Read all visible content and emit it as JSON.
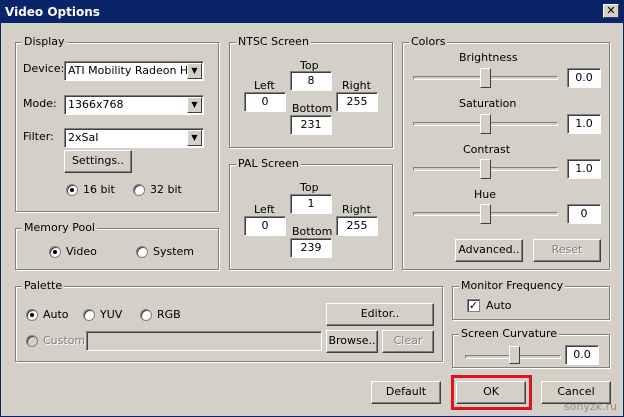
{
  "window": {
    "title": "Video Options"
  },
  "display": {
    "legend": "Display",
    "device_label": "Device:",
    "device_value": "ATI Mobility Radeon HD",
    "mode_label": "Mode:",
    "mode_value": "1366x768",
    "filter_label": "Filter:",
    "filter_value": "2xSaI",
    "settings_btn": "Settings..",
    "bit16": "16 bit",
    "bit32": "32 bit"
  },
  "ntsc": {
    "legend": "NTSC Screen",
    "top_label": "Top",
    "top": "8",
    "left_label": "Left",
    "left": "0",
    "right_label": "Right",
    "right": "255",
    "bottom_label": "Bottom",
    "bottom": "231"
  },
  "pal": {
    "legend": "PAL Screen",
    "top_label": "Top",
    "top": "1",
    "left_label": "Left",
    "left": "0",
    "right_label": "Right",
    "right": "255",
    "bottom_label": "Bottom",
    "bottom": "239"
  },
  "colors": {
    "legend": "Colors",
    "brightness_label": "Brightness",
    "brightness": "0.0",
    "saturation_label": "Saturation",
    "saturation": "1.0",
    "contrast_label": "Contrast",
    "contrast": "1.0",
    "hue_label": "Hue",
    "hue": "0",
    "advanced_btn": "Advanced..",
    "reset_btn": "Reset"
  },
  "memory": {
    "legend": "Memory Pool",
    "video": "Video",
    "system": "System"
  },
  "palette": {
    "legend": "Palette",
    "auto": "Auto",
    "yuv": "YUV",
    "rgb": "RGB",
    "custom": "Custom",
    "editor_btn": "Editor..",
    "browse_btn": "Browse..",
    "clear_btn": "Clear"
  },
  "monitor": {
    "legend": "Monitor Frequency",
    "auto": "Auto"
  },
  "curvature": {
    "legend": "Screen Curvature",
    "value": "0.0"
  },
  "footer": {
    "default_btn": "Default",
    "ok_btn": "OK",
    "cancel_btn": "Cancel"
  },
  "watermark": "sonyzk.ru",
  "colors_hex": {
    "titlebar": "#0a246a",
    "face": "#d4d0c8",
    "highlight": "#e0141e"
  }
}
